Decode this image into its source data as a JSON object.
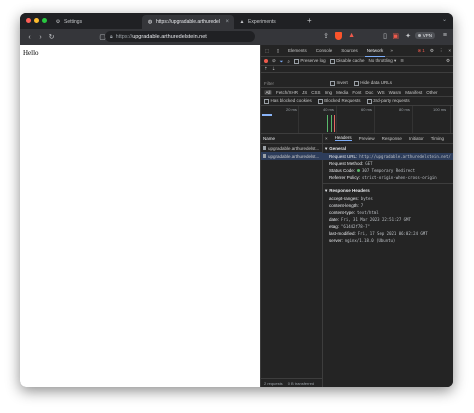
{
  "tabs": [
    {
      "title": "Settings",
      "icon": "gear-icon"
    },
    {
      "title": "https://upgradable.arthuredelstein.net/",
      "icon": "globe-icon"
    },
    {
      "title": "Experiments",
      "icon": "flask-icon"
    }
  ],
  "toolbar": {
    "url_prefix": "https://",
    "url_host": "upgradable.arthuredelstein.net",
    "shield_count": "1",
    "vpn_label": "VPN"
  },
  "page": {
    "body_text": "Hello"
  },
  "devtools": {
    "tabs": [
      "Elements",
      "Console",
      "Sources",
      "Network"
    ],
    "active_tab": "Network",
    "error_count": "1",
    "preserve_log": "Preserve log",
    "disable_cache": "Disable cache",
    "throttling": "No throttling",
    "filter_placeholder": "Filter",
    "invert": "Invert",
    "hide_data_urls": "Hide data URLs",
    "types": [
      "All",
      "Fetch/XHR",
      "JS",
      "CSS",
      "Img",
      "Media",
      "Font",
      "Doc",
      "WS",
      "Wasm",
      "Manifest",
      "Other"
    ],
    "has_blocked_cookies": "Has blocked cookies",
    "blocked_requests": "Blocked Requests",
    "third_party": "3rd-party requests",
    "timeline_ticks": [
      "20 ms",
      "40 ms",
      "60 ms",
      "80 ms",
      "100 ms"
    ],
    "name_header": "Name",
    "requests": [
      "upgradable.arthuredelst...",
      "upgradable.arthuredelst..."
    ],
    "status_requests": "2 requests",
    "status_transferred": "0 B transferred",
    "detail_tabs": [
      "Headers",
      "Preview",
      "Response",
      "Initiator",
      "Timing"
    ],
    "general_title": "General",
    "general": [
      {
        "k": "Request URL:",
        "v": "http://upgradable.arthuredelstein.net/"
      },
      {
        "k": "Request Method:",
        "v": "GET"
      },
      {
        "k": "Status Code:",
        "v": "307 Temporary Redirect"
      },
      {
        "k": "Referrer Policy:",
        "v": "strict-origin-when-cross-origin"
      }
    ],
    "response_title": "Response Headers",
    "response": [
      {
        "k": "accept-ranges:",
        "v": "bytes"
      },
      {
        "k": "content-length:",
        "v": "7"
      },
      {
        "k": "content-type:",
        "v": "text/html"
      },
      {
        "k": "date:",
        "v": "Fri, 31 Mar 2023 22:51:27 GMT"
      },
      {
        "k": "etag:",
        "v": "\"61442f78-7\""
      },
      {
        "k": "last-modified:",
        "v": "Fri, 17 Sep 2021 06:02:24 GMT"
      },
      {
        "k": "server:",
        "v": "nginx/1.18.0 (Ubuntu)"
      }
    ]
  }
}
